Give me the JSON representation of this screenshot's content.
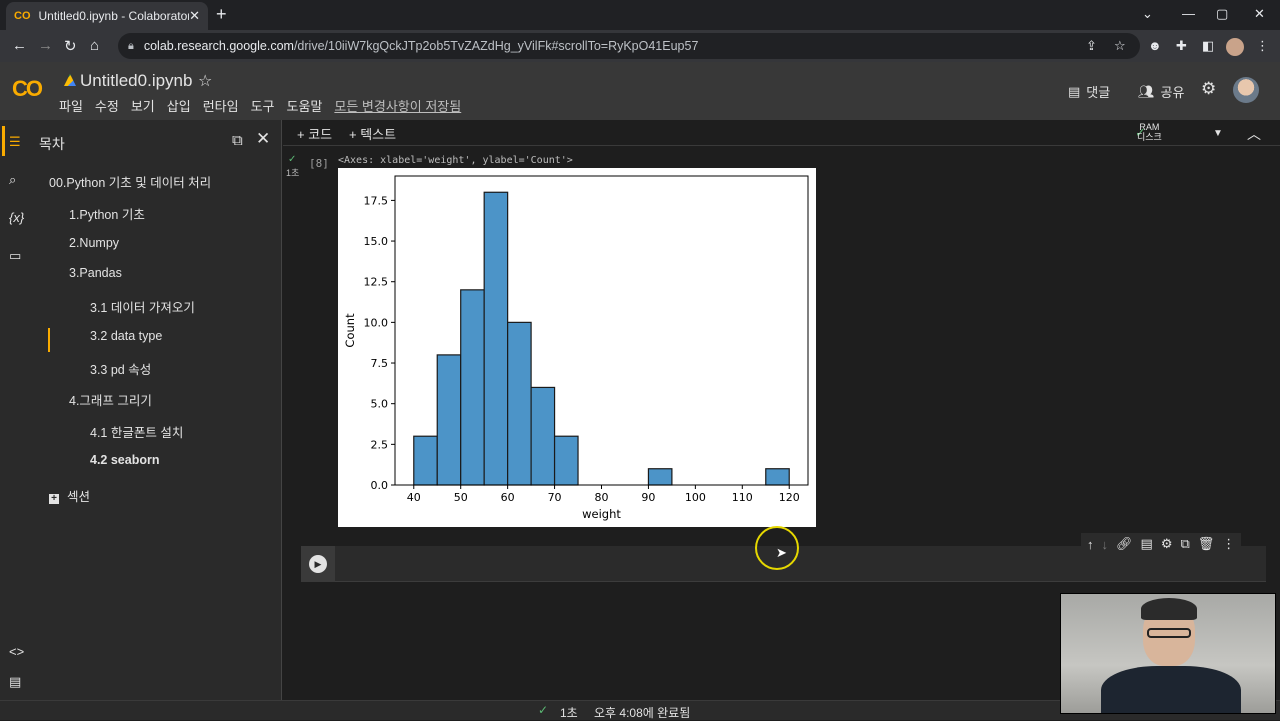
{
  "browser": {
    "tab_title": "Untitled0.ipynb - Colaboratory",
    "tab_favicon": "CO",
    "url_host": "colab.research.google.com",
    "url_path": "/drive/10iiW7kgQckJTp2ob5TvZAZdHg_yVilFk#scrollTo=RyKpO41Eup57"
  },
  "colab": {
    "logo": "CO",
    "notebook_title": "Untitled0.ipynb",
    "menu": [
      "파일",
      "수정",
      "보기",
      "삽입",
      "런타임",
      "도구",
      "도움말"
    ],
    "saved_status": "모든 변경사항이 저장됨",
    "comment_label": "댓글",
    "share_label": "공유",
    "accent_color": "#f9ab00"
  },
  "sidebar": {
    "title": "목차",
    "toc": [
      {
        "label": "00.Python 기초 및 데이터 처리",
        "level": 1
      },
      {
        "label": "1.Python 기초",
        "level": 2
      },
      {
        "label": "2.Numpy",
        "level": 2
      },
      {
        "label": "3.Pandas",
        "level": 2
      },
      {
        "label": "3.1 데이터 가져오기",
        "level": 3
      },
      {
        "label": "3.2 data type",
        "level": 3
      },
      {
        "label": "3.3 pd 속성",
        "level": 3
      },
      {
        "label": "4.그래프 그리기",
        "level": 2
      },
      {
        "label": "4.1 한글폰트 설치",
        "level": 3
      },
      {
        "label": "4.2 seaborn",
        "level": 3,
        "active": true
      }
    ],
    "add_section": "섹션"
  },
  "toolbar": {
    "add_code": "+ 코드",
    "add_text": "+ 텍스트",
    "ram_label": "RAM",
    "disk_label": "디스크"
  },
  "cell": {
    "exec_count": "[8]",
    "exec_time": "1초",
    "output_repr": "<Axes: xlabel='weight', ylabel='Count'>"
  },
  "chart_data": {
    "type": "bar",
    "title": "",
    "xlabel": "weight",
    "ylabel": "Count",
    "bin_edges": [
      40,
      45,
      50,
      55,
      60,
      65,
      70,
      75,
      80,
      85,
      90,
      95,
      100,
      105,
      110,
      115,
      120
    ],
    "counts": [
      3,
      8,
      12,
      18,
      10,
      6,
      3,
      0,
      0,
      0,
      1,
      0,
      0,
      0,
      0,
      1
    ],
    "xlim": [
      36,
      124
    ],
    "ylim": [
      0,
      19
    ],
    "xticks": [
      40,
      50,
      60,
      70,
      80,
      90,
      100,
      110,
      120
    ],
    "yticks": [
      "0.0",
      "2.5",
      "5.0",
      "7.5",
      "10.0",
      "12.5",
      "15.0",
      "17.5"
    ],
    "bar_color": "#4c94c8",
    "grid": false
  },
  "status": {
    "duration": "1초",
    "message": "오후 4:08에 완료됨"
  }
}
